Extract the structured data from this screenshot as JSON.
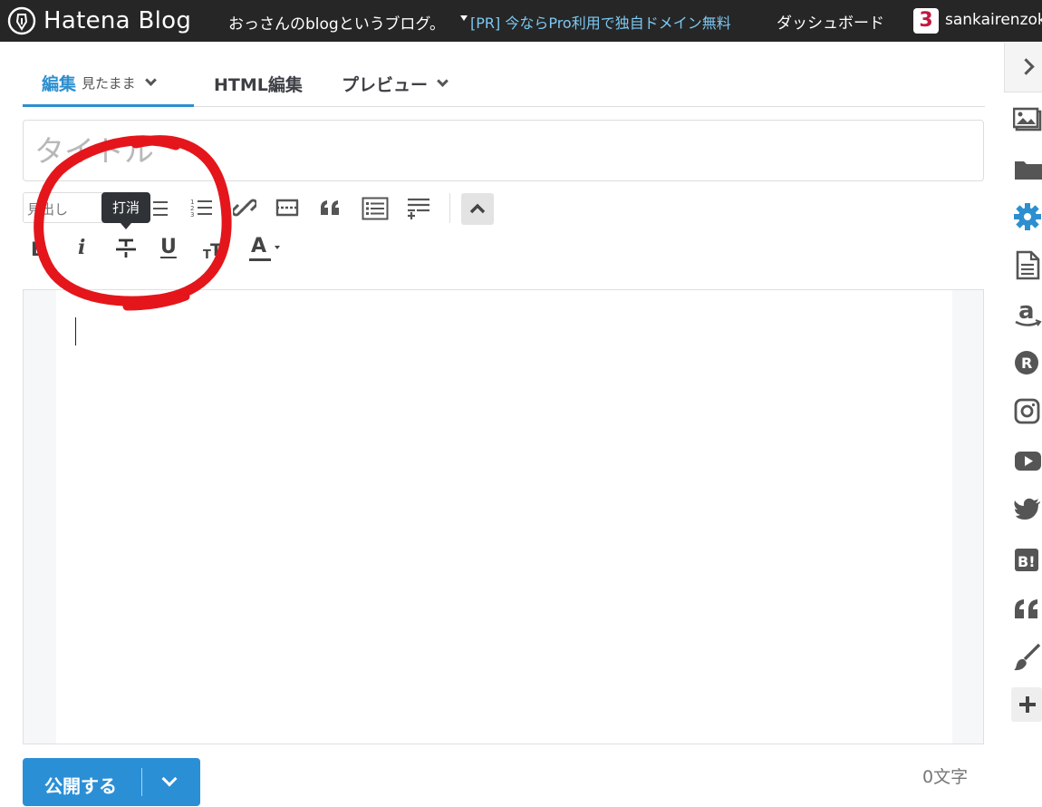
{
  "topbar": {
    "logo_text": "Hatena Blog",
    "blog_title": "おっさんのblogというブログ。",
    "pr_link": "[PR] 今ならPro利用で独自ドメイン無料",
    "dashboard": "ダッシュボード",
    "user_badge": "3",
    "user_name": "sankairenzoku"
  },
  "tabs": {
    "edit": "編集",
    "edit_mode": "見たまま",
    "html": "HTML編集",
    "preview": "プレビュー"
  },
  "title_field": {
    "placeholder": "タイトル",
    "value": ""
  },
  "toolbar": {
    "heading_select": "見出し",
    "tooltip": "打消",
    "italic": "i",
    "underline": "U",
    "font_color": "A"
  },
  "editor": {
    "content": ""
  },
  "footer": {
    "publish_label": "公開する",
    "char_count": "0文字"
  },
  "colors": {
    "topbar_bg": "#262626",
    "accent": "#2c8fcf",
    "publish_bg": "#2b8fd6",
    "annotation": "#e4161b",
    "pr_link": "#7cc8f2",
    "user_badge": "#c2183f"
  },
  "icons": [
    "hatena-pen-icon",
    "chevron-down-icon",
    "bullet-list-icon",
    "numbered-list-icon",
    "link-icon",
    "more-separator-icon",
    "quote-icon",
    "table-of-contents-icon",
    "footnote-icon",
    "collapse-up-icon",
    "bold-icon",
    "strikethrough-icon",
    "text-size-icon",
    "photo-icon",
    "folder-icon",
    "gear-icon",
    "document-icon",
    "amazon-icon",
    "rakuten-icon",
    "instagram-icon",
    "youtube-icon",
    "twitter-icon",
    "hatena-bookmark-icon",
    "quote-icon",
    "brush-icon",
    "plus-icon"
  ]
}
